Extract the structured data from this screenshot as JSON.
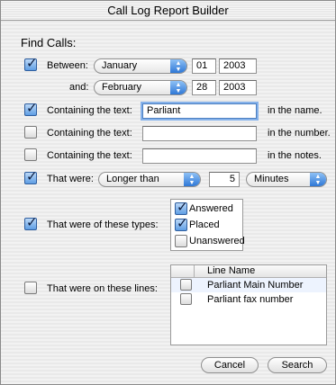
{
  "window": {
    "title": "Call Log Report Builder"
  },
  "find_calls_title": "Find Calls:",
  "between": {
    "checked": true,
    "label": "Between:",
    "start_month": "January",
    "start_day": "01",
    "start_year": "2003",
    "and_label": "and:",
    "end_month": "February",
    "end_day": "28",
    "end_year": "2003"
  },
  "name_filter": {
    "checked": true,
    "label": "Containing the text:",
    "value": "Parliant",
    "suffix": "in the name."
  },
  "number_filter": {
    "checked": false,
    "label": "Containing the text:",
    "value": "",
    "suffix": "in the number."
  },
  "notes_filter": {
    "checked": false,
    "label": "Containing the text:",
    "value": "",
    "suffix": "in the notes."
  },
  "duration": {
    "checked": true,
    "label": "That were:",
    "comparison": "Longer than",
    "amount": "5",
    "unit": "Minutes"
  },
  "types": {
    "checked": true,
    "label": "That were of these  types:",
    "options": [
      {
        "label": "Answered",
        "checked": true
      },
      {
        "label": "Placed",
        "checked": true
      },
      {
        "label": "Unanswered",
        "checked": false
      }
    ]
  },
  "lines": {
    "checked": false,
    "label": "That were on these lines:",
    "column_header": "Line Name",
    "rows": [
      {
        "name": "Parliant Main Number",
        "checked": false
      },
      {
        "name": "Parliant fax number",
        "checked": false
      }
    ]
  },
  "buttons": {
    "cancel": "Cancel",
    "search": "Search"
  },
  "icons": {
    "popup_arrows": "up-down-arrows-icon",
    "checkmark": "checkmark-icon"
  },
  "colors": {
    "accent": "#2f78d6",
    "focus_ring": "#86b2ea"
  }
}
